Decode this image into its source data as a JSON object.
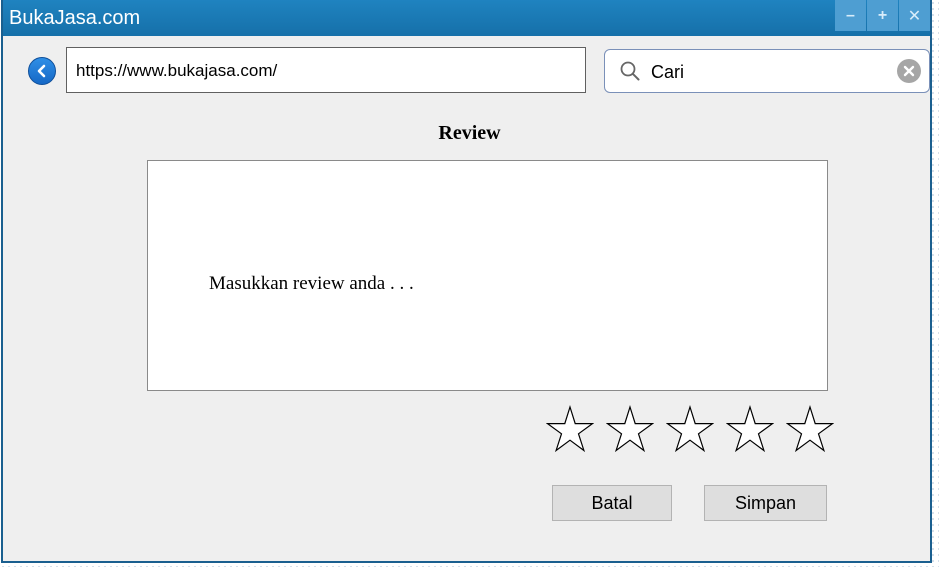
{
  "window": {
    "title": "BukaJasa.com",
    "controls": {
      "minimize": "–",
      "maximize": "+",
      "close": "✕"
    }
  },
  "navbar": {
    "url": "https://www.bukajasa.com/",
    "search_placeholder": "Cari"
  },
  "review": {
    "title": "Review",
    "placeholder": "Masukkan review anda . . .",
    "rating": {
      "value": 0,
      "max": 5
    }
  },
  "buttons": {
    "cancel": "Batal",
    "save": "Simpan"
  },
  "colors": {
    "titlebar": "#1a78b6",
    "window_bg": "#efefef",
    "accent": "#1f6fd0"
  }
}
